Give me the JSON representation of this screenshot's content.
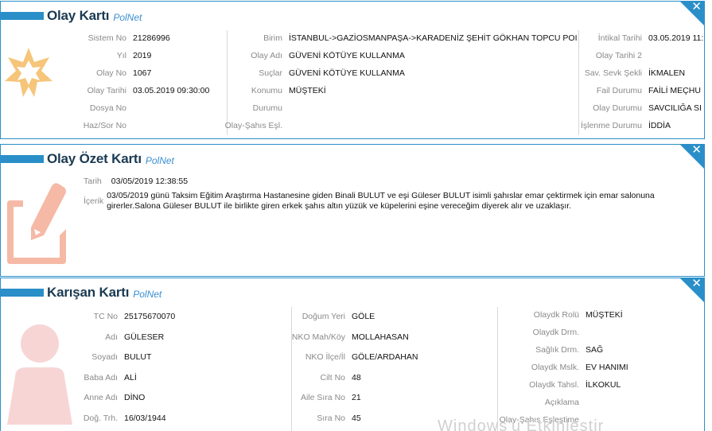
{
  "brand": "PolNet",
  "close_glyph": "✕",
  "colors": {
    "accent": "#2a8fc8",
    "title": "#1a3a52",
    "label": "#8a8a8a",
    "icon_orange": "#f6c57a",
    "icon_salmon": "#f5b9a6",
    "icon_pink": "#f7d5d5"
  },
  "olay": {
    "title": "Olay Kartı",
    "icon": "star-burst-icon",
    "col1": [
      {
        "label": "Sistem No",
        "value": "21286996"
      },
      {
        "label": "Yıl",
        "value": "2019"
      },
      {
        "label": "Olay No",
        "value": "1067"
      },
      {
        "label": "Olay Tarihi",
        "value": "03.05.2019 09:30:00"
      },
      {
        "label": "Dosya No",
        "value": ""
      },
      {
        "label": "Haz/Sor No",
        "value": ""
      }
    ],
    "col2": [
      {
        "label": "Birim",
        "value": "İSTANBUL->GAZİOSMANPAŞA->KARADENİZ ŞEHİT GÖKHAN TOPCU POI"
      },
      {
        "label": "Olay Adı",
        "value": "GÜVENİ KÖTÜYE KULLANMA"
      },
      {
        "label": "Suçlar",
        "value": "GÜVENİ KÖTÜYE KULLANMA"
      },
      {
        "label": "Konumu",
        "value": "MÜŞTEKİ"
      },
      {
        "label": "Durumu",
        "value": ""
      },
      {
        "label": "Olay-Şahıs Eşl.",
        "value": ""
      }
    ],
    "col3": [
      {
        "label": "İntikal Tarihi",
        "value": "03.05.2019 11:"
      },
      {
        "label": "Olay Tarihi 2",
        "value": ""
      },
      {
        "label": "Sav. Sevk Şekli",
        "value": "İKMALEN"
      },
      {
        "label": "Fail Durumu",
        "value": "FAİLİ MEÇHU"
      },
      {
        "label": "Olay Durumu",
        "value": "SAVCILIĞA SI"
      },
      {
        "label": "İşlenme Durumu",
        "value": "İDDİA"
      }
    ]
  },
  "ozet": {
    "title": "Olay Özet Kartı",
    "icon": "note-edit-icon",
    "date_label": "Tarih",
    "date_value": "03/05/2019 12:38:55",
    "content_label": "İçerik",
    "content_line1": "03/05/2019 günü Taksim Eğitim Araştırma Hastanesine giden Binali BULUT ve eşi Güleser BULUT isimli şahıslar emar çektirmek için emar salonuna",
    "content_line2": "girerler.Salona Güleser BULUT ile birlikte giren erkek şahıs altın yüzük ve küpelerini eşine vereceğim diyerek alır ve uzaklaşır."
  },
  "karisan": {
    "title": "Karışan Kartı",
    "icon": "person-icon",
    "col1": [
      {
        "label": "TC No",
        "value": "25175670070"
      },
      {
        "label": "Adı",
        "value": "GÜLESER"
      },
      {
        "label": "Soyadı",
        "value": "BULUT"
      },
      {
        "label": "Baba Adı",
        "value": "ALİ"
      },
      {
        "label": "Anne Adı",
        "value": "DİNO"
      },
      {
        "label": "Doğ. Trh.",
        "value": "16/03/1944"
      }
    ],
    "col2": [
      {
        "label": "Doğum Yeri",
        "value": "GÖLE"
      },
      {
        "label": "NKO Mah/Köy",
        "value": "MOLLAHASAN"
      },
      {
        "label": "NKO İlçe/İl",
        "value": "GÖLE/ARDAHAN"
      },
      {
        "label": "Cilt No",
        "value": "48"
      },
      {
        "label": "Aile Sıra No",
        "value": "21"
      },
      {
        "label": "Sıra No",
        "value": "45"
      }
    ],
    "col3": [
      {
        "label": "Olaydk Rolü",
        "value": "MÜŞTEKİ"
      },
      {
        "label": "Olaydk Drm.",
        "value": ""
      },
      {
        "label": "Sağlık Drm.",
        "value": "SAĞ"
      },
      {
        "label": "Olaydk Mslk.",
        "value": "EV HANIMI"
      },
      {
        "label": "Olaydk Tahsl.",
        "value": "İLKOKUL"
      },
      {
        "label": "Açıklama",
        "value": ""
      },
      {
        "label": "Olay-Şahıs Eşleştime",
        "value": ""
      }
    ]
  }
}
